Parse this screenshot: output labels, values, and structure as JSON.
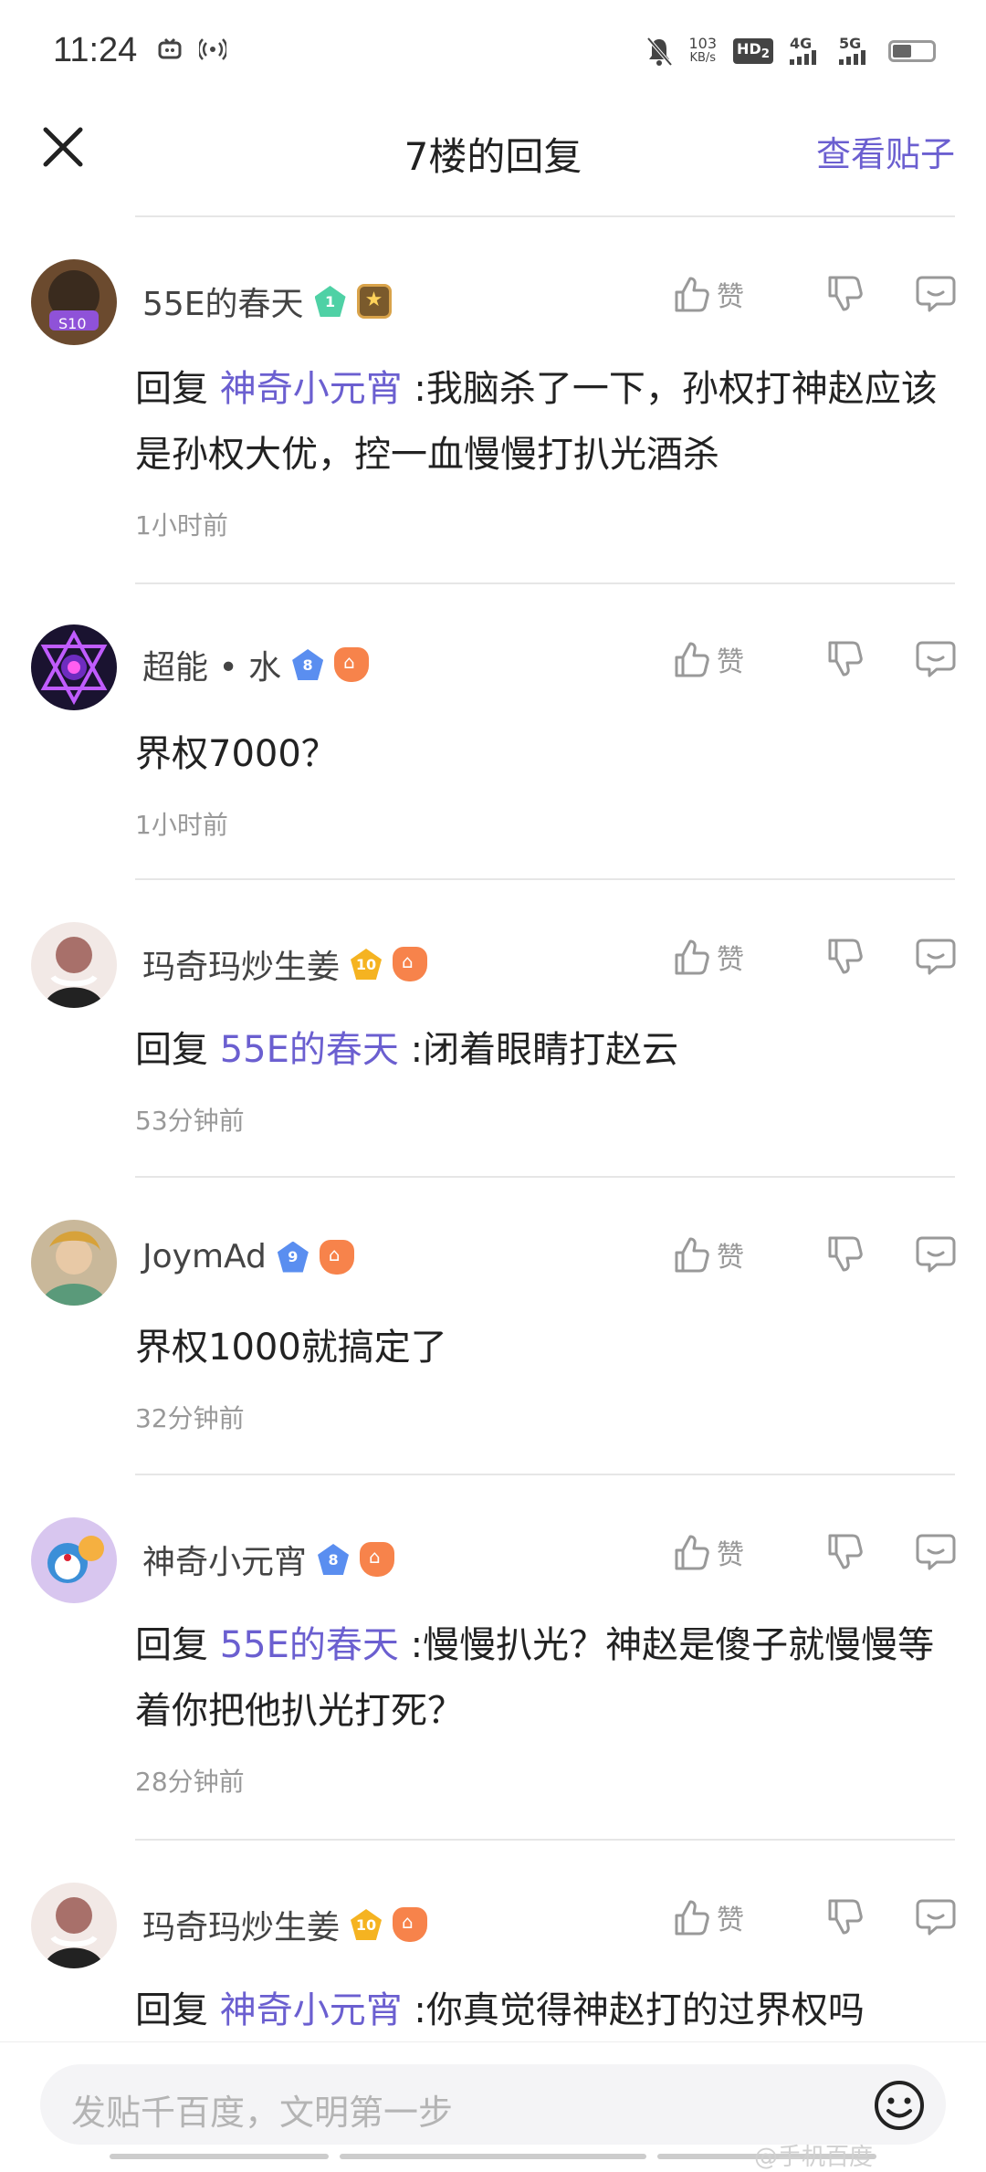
{
  "status": {
    "time": "11:24",
    "netspeed_value": "103",
    "netspeed_unit": "KB/s",
    "hd": "HD",
    "hd_sub": "2",
    "net1": "4G",
    "net2": "5G"
  },
  "nav": {
    "title": "7楼的回复",
    "view_post": "查看贴子"
  },
  "actions": {
    "like_label": "赞"
  },
  "comments": [
    {
      "username": "55E的春天",
      "level": "1",
      "reply_prefix": "回复",
      "mention": "神奇小元宵",
      "text": " :我脑杀了一下，孙权打神赵应该是孙权大优，控一血慢慢打扒光酒杀",
      "time": "1小时前"
    },
    {
      "username": "超能 • 水",
      "level": "8",
      "text": "界权7000？",
      "time": "1小时前"
    },
    {
      "username": "玛奇玛炒生姜",
      "level": "10",
      "reply_prefix": "回复",
      "mention": "55E的春天",
      "text": " :闭着眼睛打赵云",
      "time": "53分钟前"
    },
    {
      "username": "JoymAd",
      "level": "9",
      "text": "界权1000就搞定了",
      "time": "32分钟前"
    },
    {
      "username": "神奇小元宵",
      "level": "8",
      "reply_prefix": "回复",
      "mention": "55E的春天",
      "text": " :慢慢扒光？神赵是傻子就慢慢等着你把他扒光打死？",
      "time": "28分钟前"
    },
    {
      "username": "玛奇玛炒生姜",
      "level": "10",
      "reply_prefix": "回复",
      "mention": "神奇小元宵",
      "text": " :你真觉得神赵打的过界权吗"
    }
  ],
  "composer": {
    "placeholder": "发贴千百度，文明第一步"
  },
  "watermark": "@手机百度"
}
